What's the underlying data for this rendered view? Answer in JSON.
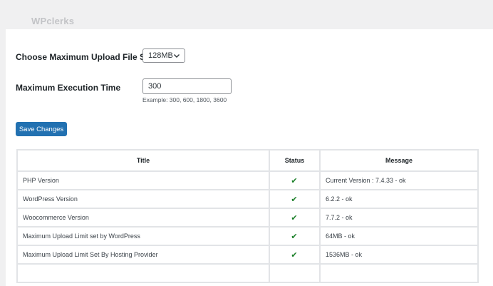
{
  "brand": {
    "prefix": "WP",
    "suffix": "clerks"
  },
  "settings": {
    "upload_label": "Choose Maximum Upload File Size",
    "upload_value": "128MB",
    "exec_label": "Maximum Execution Time",
    "exec_value": "300",
    "exec_hint": "Example: 300, 600, 1800, 3600",
    "save_label": "Save Changes"
  },
  "table": {
    "headers": {
      "title": "Title",
      "status": "Status",
      "message": "Message"
    },
    "rows": [
      {
        "title": "PHP Version",
        "status": "ok",
        "message": "Current Version : 7.4.33 - ok"
      },
      {
        "title": "WordPress Version",
        "status": "ok",
        "message": "6.2.2 - ok"
      },
      {
        "title": "Woocommerce Version",
        "status": "ok",
        "message": "7.7.2 - ok"
      },
      {
        "title": "Maximum Upload Limit set by WordPress",
        "status": "ok",
        "message": "64MB - ok"
      },
      {
        "title": "Maximum Upload Limit Set By Hosting Provider",
        "status": "ok",
        "message": "1536MB - ok"
      },
      {
        "title": "",
        "status": "",
        "message": ""
      }
    ]
  },
  "icons": {
    "check": "check-icon",
    "chevron": "chevron-down-icon"
  },
  "colors": {
    "primary": "#2271b1",
    "check": "#1a7f28"
  }
}
